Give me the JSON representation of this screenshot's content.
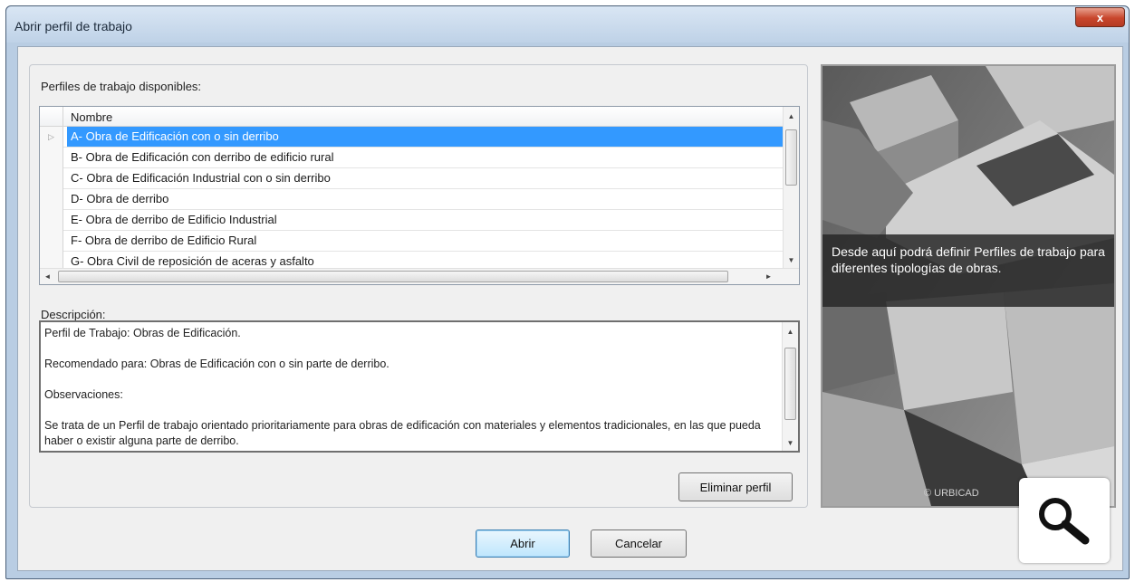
{
  "window": {
    "title": "Abrir perfil de trabajo",
    "close_glyph": "x"
  },
  "profiles": {
    "label": "Perfiles de trabajo disponibles:",
    "column_header": "Nombre",
    "row_indicator": "▷",
    "rows": [
      "A- Obra de Edificación con o sin derribo",
      "B- Obra de Edificación con derribo de edificio rural",
      "C- Obra de Edificación Industrial con o sin derribo",
      "D- Obra de derribo",
      "E- Obra de derribo de Edificio Industrial",
      "F- Obra de derribo de Edificio Rural",
      "G- Obra Civil de reposición de aceras y asfalto"
    ],
    "selected_index": 0
  },
  "description": {
    "label": "Descripción:",
    "paragraphs": [
      "Perfil de Trabajo: Obras de Edificación.",
      "Recomendado para: Obras de Edificación con o sin parte de derribo.",
      "Observaciones:",
      "Se trata de un Perfil de trabajo orientado prioritariamente para obras de edificación con materiales y elementos tradicionales, en las que pueda haber o existir alguna parte de derribo."
    ]
  },
  "buttons": {
    "delete_profile": "Eliminar perfil",
    "open": "Abrir",
    "cancel": "Cancelar"
  },
  "side_panel": {
    "caption": "Desde aquí podrá definir Perfiles de trabajo para diferentes tipologías de obras.",
    "copyright": "© URBICAD"
  },
  "icons": {
    "zoom": "magnifier-icon"
  },
  "colors": {
    "selection": "#3399ff",
    "title_bar": "#c9daee",
    "close_button": "#c8462d"
  }
}
